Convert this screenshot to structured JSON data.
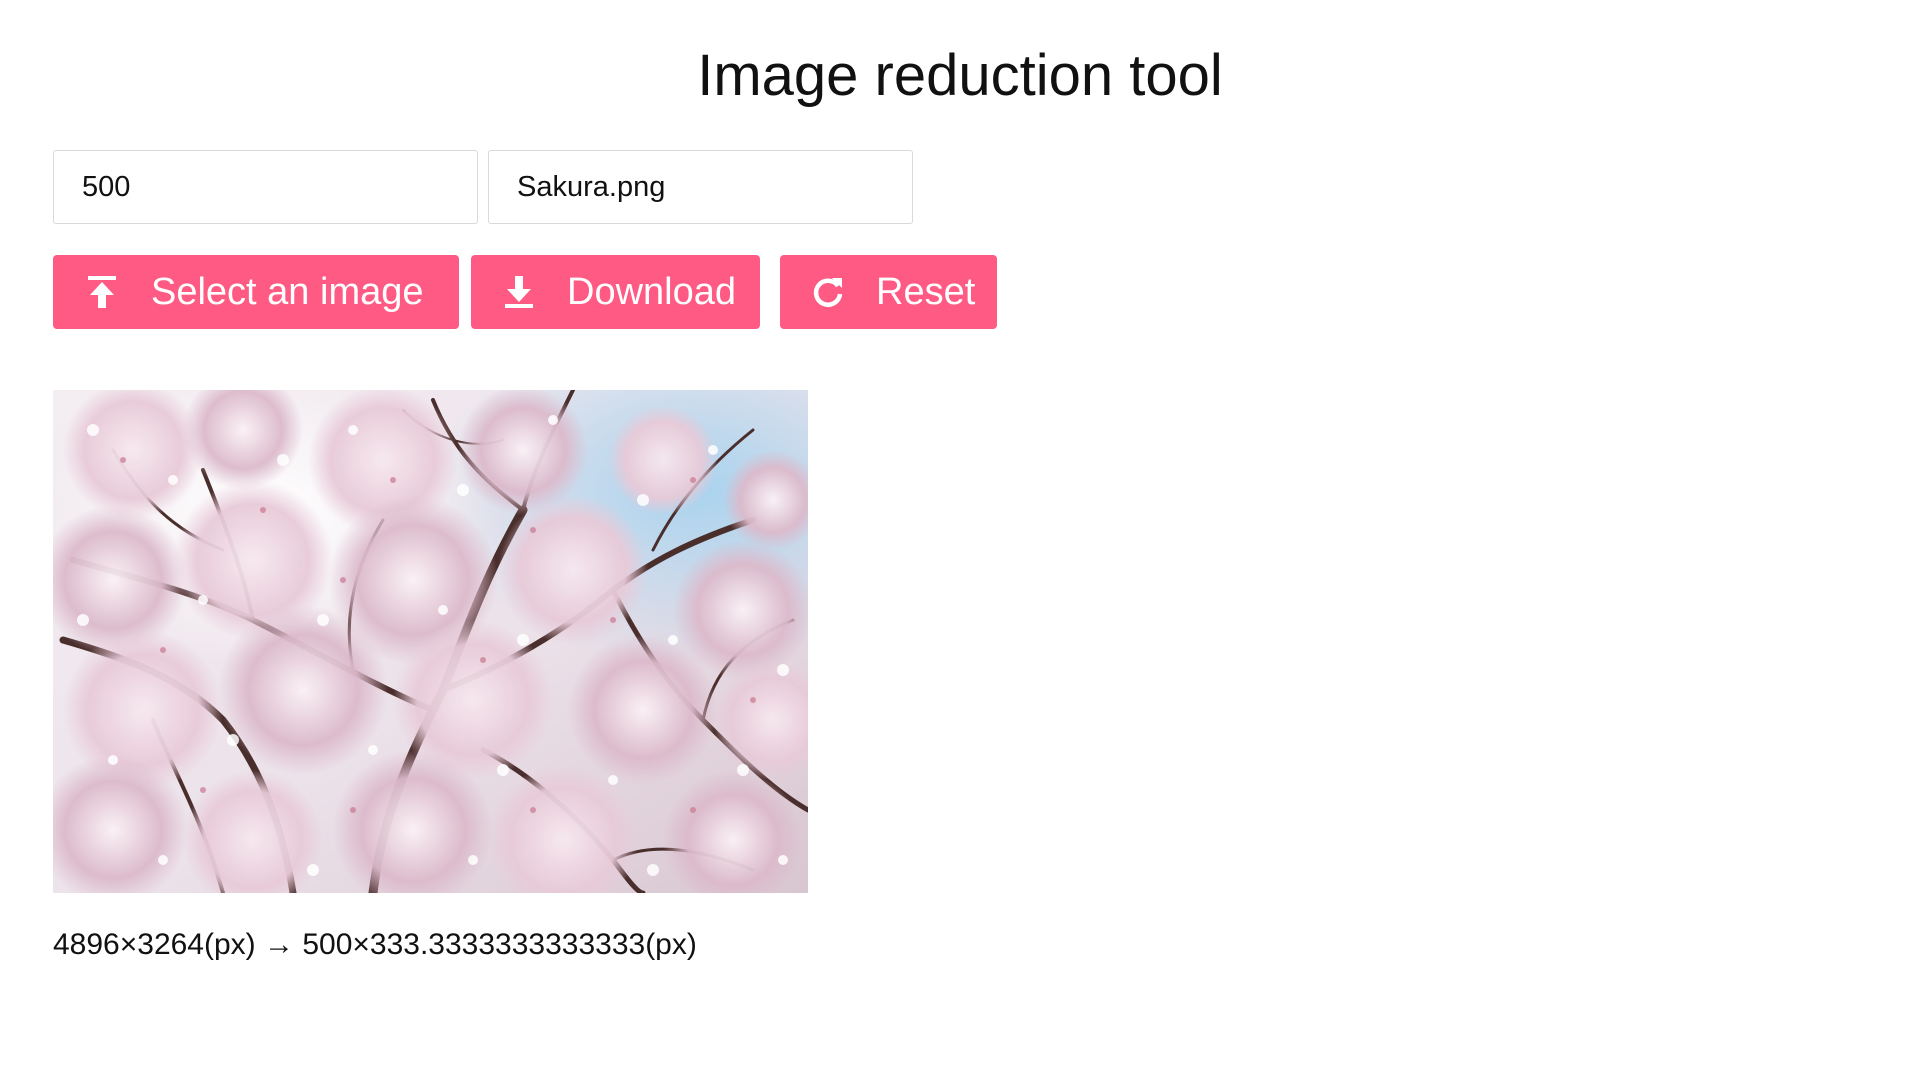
{
  "header": {
    "title": "Image reduction tool"
  },
  "inputs": {
    "width_value": "500",
    "filename_value": "Sakura.png"
  },
  "buttons": {
    "select_label": "Select an image",
    "select_icon": "upload-icon",
    "download_label": "Download",
    "download_icon": "download-icon",
    "reset_label": "Reset",
    "reset_icon": "refresh-icon"
  },
  "preview": {
    "subject": "cherry-blossom-photo"
  },
  "result": {
    "size_text": "4896×3264(px) → 500×333.3333333333333(px)"
  },
  "colors": {
    "accent": "#ff5a83",
    "background": "#ffffff",
    "text": "#111111"
  }
}
